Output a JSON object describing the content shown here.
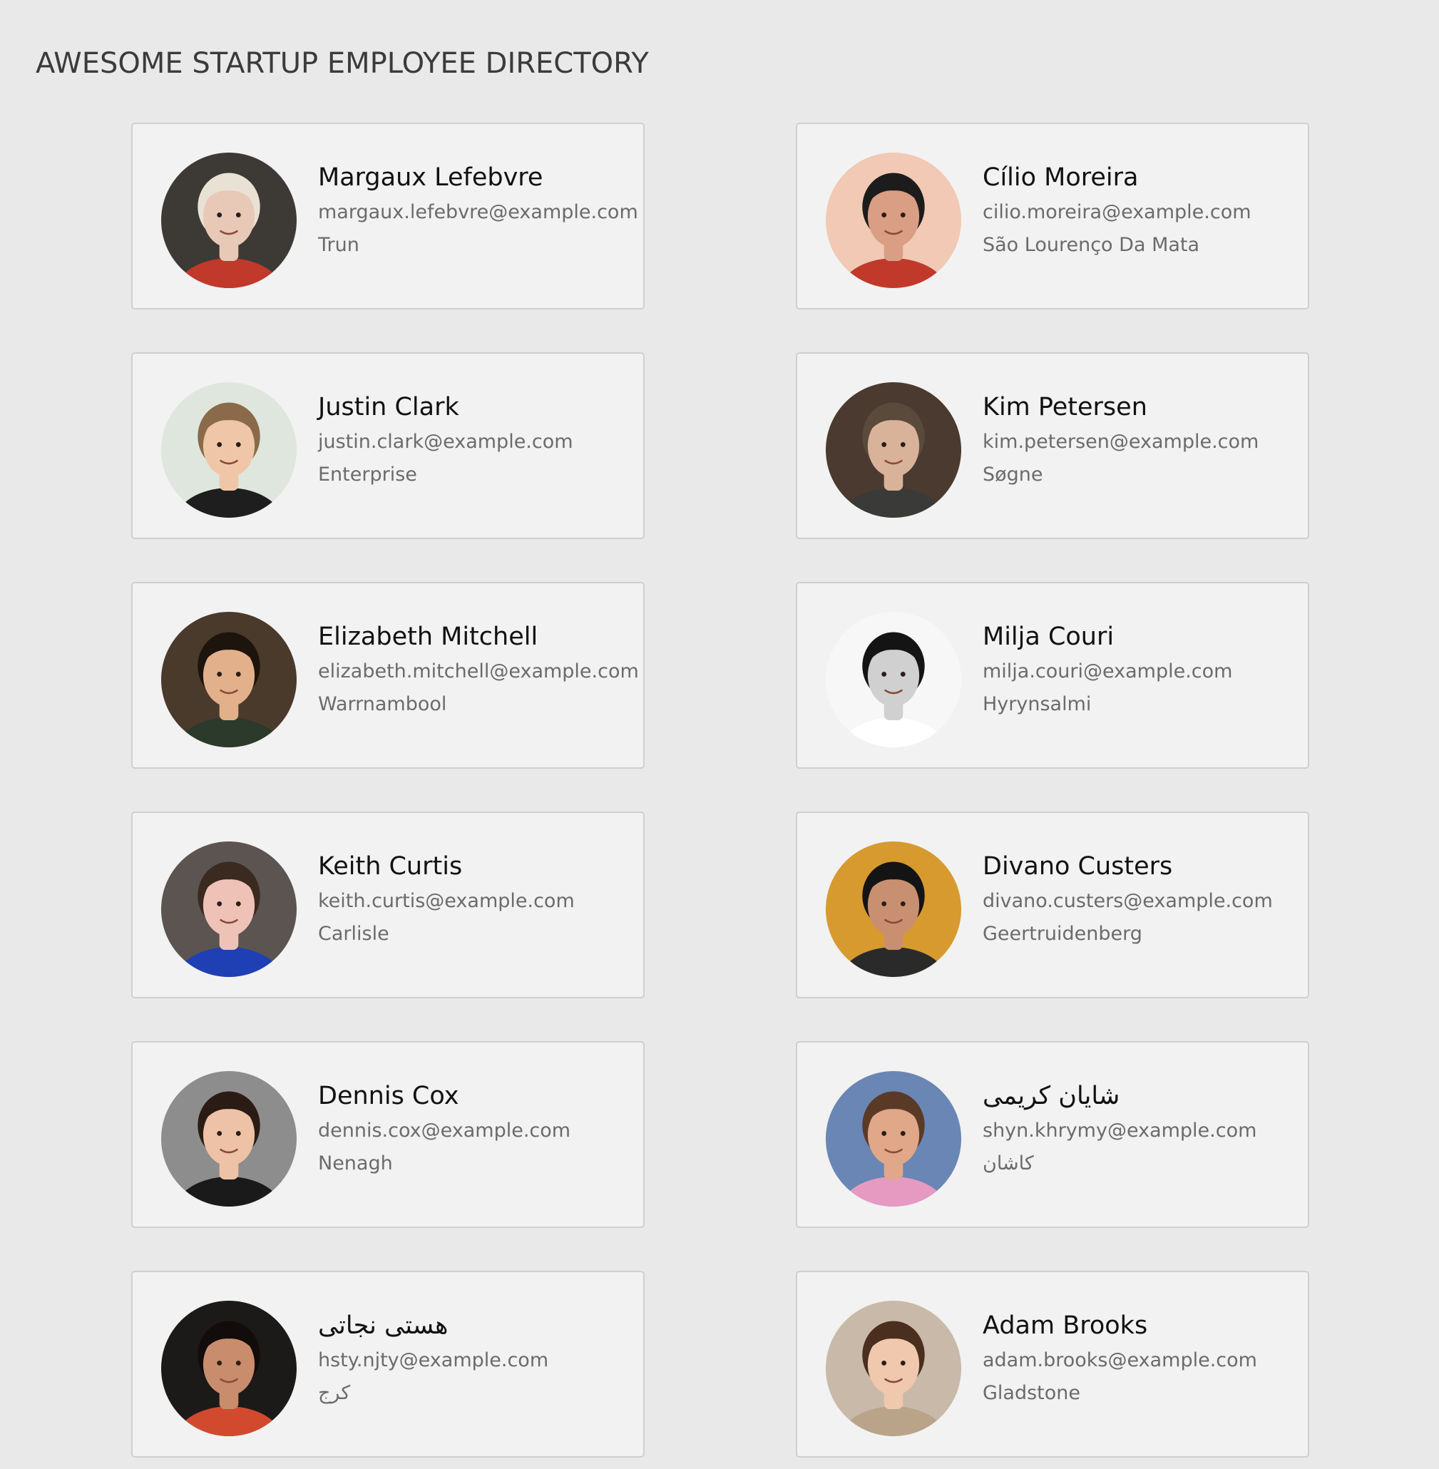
{
  "header": {
    "title": "AWESOME STARTUP EMPLOYEE DIRECTORY"
  },
  "employees": [
    {
      "name": "Margaux Lefebvre",
      "email": "margaux.lefebvre@example.com",
      "city": "Trun",
      "avatar_bg": "#3d3a36",
      "skin": "#e8c9b8",
      "hair": "#e9e2d4",
      "shirt": "#c0392b"
    },
    {
      "name": "Cílio Moreira",
      "email": "cilio.moreira@example.com",
      "city": "São Lourenço Da Mata",
      "avatar_bg": "#f1c9b4",
      "skin": "#d99e84",
      "hair": "#1c1c1c",
      "shirt": "#c0392b"
    },
    {
      "name": "Justin Clark",
      "email": "justin.clark@example.com",
      "city": "Enterprise",
      "avatar_bg": "#dfe6dd",
      "skin": "#efc7a8",
      "hair": "#8a6a4a",
      "shirt": "#1e1e1e"
    },
    {
      "name": "Kim Petersen",
      "email": "kim.petersen@example.com",
      "city": "Søgne",
      "avatar_bg": "#4b3a2f",
      "skin": "#d8b39a",
      "hair": "#5a4a3c",
      "shirt": "#3a3a38"
    },
    {
      "name": "Elizabeth Mitchell",
      "email": "elizabeth.mitchell@example.com",
      "city": "Warrnambool",
      "avatar_bg": "#4a3a2c",
      "skin": "#e2b08a",
      "hair": "#1e140e",
      "shirt": "#2b3a2a"
    },
    {
      "name": "Milja Couri",
      "email": "milja.couri@example.com",
      "city": "Hyrynsalmi",
      "avatar_bg": "#f7f7f7",
      "skin": "#d0d0d0",
      "hair": "#141414",
      "shirt": "#ffffff"
    },
    {
      "name": "Keith Curtis",
      "email": "keith.curtis@example.com",
      "city": "Carlisle",
      "avatar_bg": "#5b5451",
      "skin": "#efc2b8",
      "hair": "#3a2a20",
      "shirt": "#1f3fb5"
    },
    {
      "name": "Divano Custers",
      "email": "divano.custers@example.com",
      "city": "Geertruidenberg",
      "avatar_bg": "#d79a2f",
      "skin": "#c89070",
      "hair": "#141414",
      "shirt": "#2a2a2a"
    },
    {
      "name": "Dennis Cox",
      "email": "dennis.cox@example.com",
      "city": "Nenagh",
      "avatar_bg": "#8d8d8d",
      "skin": "#eec2a6",
      "hair": "#2a1c14",
      "shirt": "#1a1a1a"
    },
    {
      "name": "شایان کریمی",
      "email": "shyn.khrymy@example.com",
      "city": "کاشان",
      "avatar_bg": "#6a86b4",
      "skin": "#e0a788",
      "hair": "#5a3a26",
      "shirt": "#e69ac2"
    },
    {
      "name": "هستی نجاتی",
      "email": "hsty.njty@example.com",
      "city": "کرج",
      "avatar_bg": "#1c1a18",
      "skin": "#c98c6c",
      "hair": "#120c0a",
      "shirt": "#d24a2e"
    },
    {
      "name": "Adam Brooks",
      "email": "adam.brooks@example.com",
      "city": "Gladstone",
      "avatar_bg": "#c9b9a8",
      "skin": "#efc8ae",
      "hair": "#4a2e1e",
      "shirt": "#b9a48a"
    }
  ]
}
